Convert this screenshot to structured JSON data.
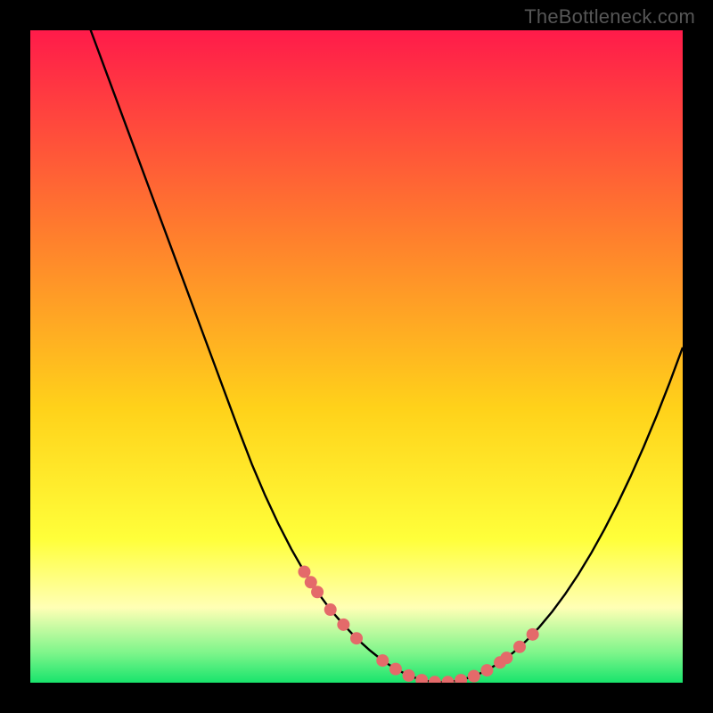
{
  "attribution": "TheBottleneck.com",
  "colors": {
    "top": "#ff1b4a",
    "mid_upper": "#ff7a2e",
    "mid": "#ffd21a",
    "lower": "#ffff3a",
    "pale": "#ffffb5",
    "green_mid": "#7cf58a",
    "green": "#18e46c",
    "curve": "#000000",
    "marker": "#e46a6a"
  },
  "chart_data": {
    "type": "line",
    "title": "",
    "xlabel": "",
    "ylabel": "",
    "xlim": [
      0,
      100
    ],
    "ylim": [
      0,
      100
    ],
    "x": [
      0,
      2,
      4,
      6,
      8,
      10,
      12,
      14,
      16,
      18,
      20,
      22,
      24,
      26,
      28,
      30,
      32,
      34,
      36,
      38,
      40,
      42,
      44,
      46,
      48,
      50,
      52,
      54,
      56,
      58,
      60,
      62,
      64,
      66,
      68,
      70,
      72,
      74,
      76,
      78,
      80,
      82,
      84,
      86,
      88,
      90,
      92,
      94,
      96,
      98,
      100
    ],
    "values": [
      125,
      119.6,
      114.2,
      108.8,
      103.4,
      98,
      92.6,
      87.2,
      81.8,
      76.4,
      71,
      65.6,
      60.2,
      54.8,
      49.4,
      44,
      38.6,
      33.4,
      28.7,
      24.4,
      20.5,
      17,
      13.9,
      11.2,
      8.9,
      6.8,
      5.0,
      3.4,
      2.1,
      1.1,
      0.4,
      0.1,
      0.1,
      0.4,
      1.0,
      1.9,
      3.1,
      4.6,
      6.4,
      8.5,
      10.9,
      13.6,
      16.6,
      19.9,
      23.5,
      27.4,
      31.6,
      36.1,
      40.9,
      46.0,
      51.4
    ],
    "markers_x": [
      42,
      43,
      44,
      46,
      48,
      50,
      54,
      56,
      58,
      60,
      62,
      64,
      66,
      68,
      70,
      72,
      73,
      75,
      77
    ],
    "markers_y": [
      17.0,
      15.4,
      13.9,
      11.2,
      8.9,
      6.8,
      3.4,
      2.1,
      1.1,
      0.4,
      0.1,
      0.1,
      0.4,
      1.0,
      1.9,
      3.1,
      3.8,
      5.5,
      7.4
    ],
    "gradient_stops": [
      {
        "offset": 0.0,
        "key": "top"
      },
      {
        "offset": 0.3,
        "key": "mid_upper"
      },
      {
        "offset": 0.58,
        "key": "mid"
      },
      {
        "offset": 0.78,
        "key": "lower"
      },
      {
        "offset": 0.885,
        "key": "pale"
      },
      {
        "offset": 0.955,
        "key": "green_mid"
      },
      {
        "offset": 1.0,
        "key": "green"
      }
    ]
  }
}
